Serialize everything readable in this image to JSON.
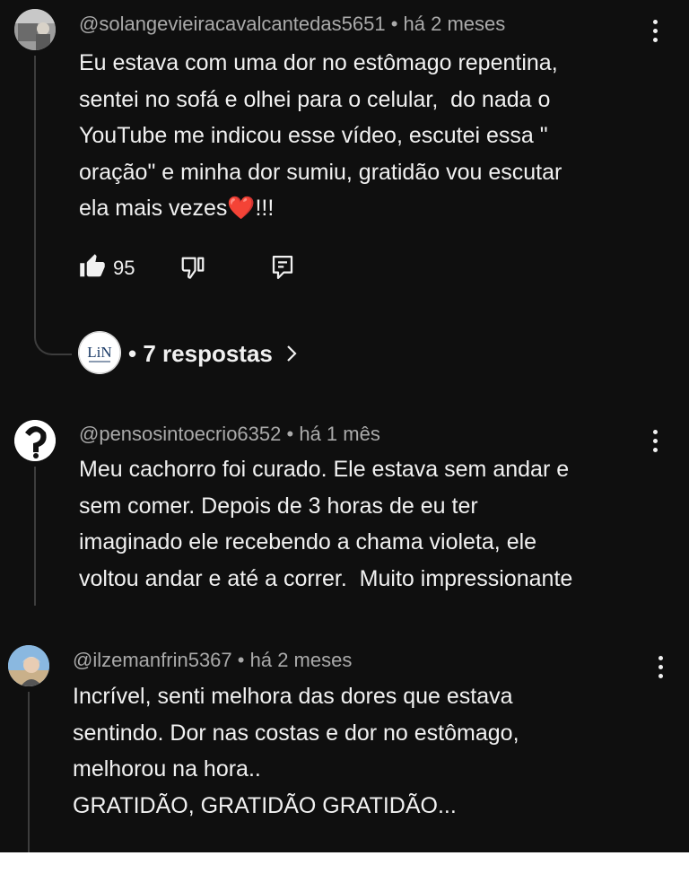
{
  "comments": [
    {
      "author": "@solangevieiracavalcantedas5651",
      "time": "há 2 meses",
      "text": "Eu estava com uma dor no estômago repentina,\nsentei no sofá e olhei para o celular,  do nada o\nYouTube me indicou esse vídeo, escutei essa \"\noração\" e minha dor sumiu, gratidão vou escutar\nela mais vezes❤️!!!",
      "likes": "95",
      "replies_label": "7 respostas",
      "reply_avatar_text": "LiN"
    },
    {
      "author": "@pensosintoecrio6352",
      "time": "há 1 mês",
      "text": "Meu cachorro foi curado. Ele estava sem andar e\nsem comer. Depois de 3 horas de eu ter\nimaginado ele recebendo a chama violeta, ele\nvoltou andar e até a correr.  Muito impressionante"
    },
    {
      "author": "@ilzemanfrin5367",
      "time": "há 2 meses",
      "text": "Incrível, senti melhora das dores que estava\nsentindo. Dor nas costas e dor no estômago,\nmelhorou na hora..\nGRATIDÃO, GRATIDÃO GRATIDÃO..."
    }
  ],
  "separator": "•",
  "icons": {
    "like": "thumb-up-icon",
    "dislike": "thumb-down-icon",
    "reply": "reply-icon",
    "menu": "kebab-menu-icon",
    "expand": "chevron-right-icon"
  },
  "colors": {
    "background": "#0f0f0f",
    "text": "#f1f1f1",
    "meta": "#aaaaaa",
    "heart": "#e53935"
  }
}
